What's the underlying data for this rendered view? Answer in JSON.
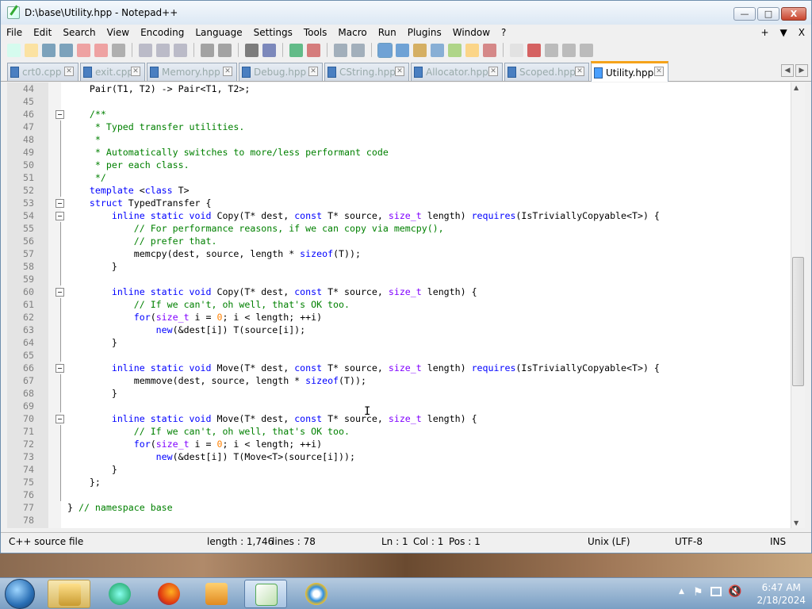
{
  "window": {
    "title": "D:\\base\\Utility.hpp - Notepad++",
    "min_label": "—",
    "max_label": "□",
    "close_label": "X"
  },
  "menu": {
    "items": [
      "File",
      "Edit",
      "Search",
      "View",
      "Encoding",
      "Language",
      "Settings",
      "Tools",
      "Macro",
      "Run",
      "Plugins",
      "Window",
      "?"
    ],
    "right": [
      "+",
      "▼",
      "X"
    ]
  },
  "tabs": [
    {
      "label": "crt0.cpp",
      "active": false
    },
    {
      "label": "exit.cpp",
      "active": false
    },
    {
      "label": "Memory.hpp",
      "active": false
    },
    {
      "label": "Debug.hpp",
      "active": false
    },
    {
      "label": "CString.hpp",
      "active": false
    },
    {
      "label": "Allocator.hpp",
      "active": false
    },
    {
      "label": "Scoped.hpp",
      "active": false
    },
    {
      "label": "Utility.hpp",
      "active": true
    }
  ],
  "code_lines": [
    {
      "n": "44",
      "fold": false,
      "segs": [
        [
          "f",
          "    Pair(T1, T2) -> Pair<T1, T2>;"
        ]
      ]
    },
    {
      "n": "45",
      "fold": false,
      "segs": []
    },
    {
      "n": "46",
      "fold": true,
      "segs": [
        [
          "c",
          "    /**"
        ]
      ]
    },
    {
      "n": "47",
      "fold": false,
      "segs": [
        [
          "c",
          "     * Typed transfer utilities."
        ]
      ]
    },
    {
      "n": "48",
      "fold": false,
      "segs": [
        [
          "c",
          "     *"
        ]
      ]
    },
    {
      "n": "49",
      "fold": false,
      "segs": [
        [
          "c",
          "     * Automatically switches to more/less performant code"
        ]
      ]
    },
    {
      "n": "50",
      "fold": false,
      "segs": [
        [
          "c",
          "     * per each class."
        ]
      ]
    },
    {
      "n": "51",
      "fold": false,
      "segs": [
        [
          "c",
          "     */"
        ]
      ]
    },
    {
      "n": "52",
      "fold": false,
      "segs": [
        [
          "k",
          "    template "
        ],
        [
          "f",
          "<"
        ],
        [
          "k",
          "class"
        ],
        [
          "f",
          " T>"
        ]
      ]
    },
    {
      "n": "53",
      "fold": true,
      "segs": [
        [
          "k",
          "    struct"
        ],
        [
          "f",
          " TypedTransfer {"
        ]
      ]
    },
    {
      "n": "54",
      "fold": true,
      "segs": [
        [
          "k",
          "        inline static void"
        ],
        [
          "f",
          " Copy(T* dest, "
        ],
        [
          "k",
          "const"
        ],
        [
          "f",
          " T* source, "
        ],
        [
          "t",
          "size_t"
        ],
        [
          "f",
          " length) "
        ],
        [
          "k",
          "requires"
        ],
        [
          "f",
          "(IsTriviallyCopyable<T>) {"
        ]
      ]
    },
    {
      "n": "55",
      "fold": false,
      "segs": [
        [
          "c",
          "            // For performance reasons, if we can copy via memcpy(),"
        ]
      ]
    },
    {
      "n": "56",
      "fold": false,
      "segs": [
        [
          "c",
          "            // prefer that."
        ]
      ]
    },
    {
      "n": "57",
      "fold": false,
      "segs": [
        [
          "f",
          "            memcpy(dest, source, length * "
        ],
        [
          "k",
          "sizeof"
        ],
        [
          "f",
          "(T));"
        ]
      ]
    },
    {
      "n": "58",
      "fold": false,
      "segs": [
        [
          "f",
          "        }"
        ]
      ]
    },
    {
      "n": "59",
      "fold": false,
      "segs": []
    },
    {
      "n": "60",
      "fold": true,
      "segs": [
        [
          "k",
          "        inline static void"
        ],
        [
          "f",
          " Copy(T* dest, "
        ],
        [
          "k",
          "const"
        ],
        [
          "f",
          " T* source, "
        ],
        [
          "t",
          "size_t"
        ],
        [
          "f",
          " length) {"
        ]
      ]
    },
    {
      "n": "61",
      "fold": false,
      "segs": [
        [
          "c",
          "            // If we can't, oh well, that's OK too."
        ]
      ]
    },
    {
      "n": "62",
      "fold": false,
      "segs": [
        [
          "k",
          "            for"
        ],
        [
          "f",
          "("
        ],
        [
          "t",
          "size_t"
        ],
        [
          "f",
          " i = "
        ],
        [
          "n",
          "0"
        ],
        [
          "f",
          "; i < length; ++i)"
        ]
      ]
    },
    {
      "n": "63",
      "fold": false,
      "segs": [
        [
          "k",
          "                new"
        ],
        [
          "f",
          "(&dest[i]) T(source[i]);"
        ]
      ]
    },
    {
      "n": "64",
      "fold": false,
      "segs": [
        [
          "f",
          "        }"
        ]
      ]
    },
    {
      "n": "65",
      "fold": false,
      "segs": []
    },
    {
      "n": "66",
      "fold": true,
      "segs": [
        [
          "k",
          "        inline static void"
        ],
        [
          "f",
          " Move(T* dest, "
        ],
        [
          "k",
          "const"
        ],
        [
          "f",
          " T* source, "
        ],
        [
          "t",
          "size_t"
        ],
        [
          "f",
          " length) "
        ],
        [
          "k",
          "requires"
        ],
        [
          "f",
          "(IsTriviallyCopyable<T>) {"
        ]
      ]
    },
    {
      "n": "67",
      "fold": false,
      "segs": [
        [
          "f",
          "            memmove(dest, source, length * "
        ],
        [
          "k",
          "sizeof"
        ],
        [
          "f",
          "(T));"
        ]
      ]
    },
    {
      "n": "68",
      "fold": false,
      "segs": [
        [
          "f",
          "        }"
        ]
      ]
    },
    {
      "n": "69",
      "fold": false,
      "segs": []
    },
    {
      "n": "70",
      "fold": true,
      "segs": [
        [
          "k",
          "        inline static void"
        ],
        [
          "f",
          " Move(T* dest, "
        ],
        [
          "k",
          "const"
        ],
        [
          "f",
          " T* source, "
        ],
        [
          "t",
          "size_t"
        ],
        [
          "f",
          " length) {"
        ]
      ]
    },
    {
      "n": "71",
      "fold": false,
      "segs": [
        [
          "c",
          "            // If we can't, oh well, that's OK too."
        ]
      ]
    },
    {
      "n": "72",
      "fold": false,
      "segs": [
        [
          "k",
          "            for"
        ],
        [
          "f",
          "("
        ],
        [
          "t",
          "size_t"
        ],
        [
          "f",
          " i = "
        ],
        [
          "n",
          "0"
        ],
        [
          "f",
          "; i < length; ++i)"
        ]
      ]
    },
    {
      "n": "73",
      "fold": false,
      "segs": [
        [
          "k",
          "                new"
        ],
        [
          "f",
          "(&dest[i]) T(Move<T>(source[i]));"
        ]
      ]
    },
    {
      "n": "74",
      "fold": false,
      "segs": [
        [
          "f",
          "        }"
        ]
      ]
    },
    {
      "n": "75",
      "fold": false,
      "segs": [
        [
          "f",
          "    };"
        ]
      ]
    },
    {
      "n": "76",
      "fold": false,
      "segs": []
    },
    {
      "n": "77",
      "fold": false,
      "segs": [
        [
          "f",
          "} "
        ],
        [
          "c",
          "// namespace base"
        ]
      ]
    },
    {
      "n": "78",
      "fold": false,
      "segs": []
    }
  ],
  "status": {
    "type": "C++ source file",
    "length": "length : 1,746",
    "lines": "lines : 78",
    "ln": "Ln : 1",
    "col": "Col : 1",
    "pos": "Pos : 1",
    "eol": "Unix (LF)",
    "encoding": "UTF-8",
    "mode": "INS"
  },
  "clock": {
    "time": "6:47 AM",
    "date": "2/18/2024"
  },
  "icons": {
    "toolbar": [
      "new-file-icon",
      "open-file-icon",
      "save-icon",
      "save-all-icon",
      "close-icon",
      "close-all-icon",
      "print-icon",
      "cut-icon",
      "copy-icon",
      "paste-icon",
      "undo-icon",
      "redo-icon",
      "find-icon",
      "replace-icon",
      "zoom-in-icon",
      "zoom-out-icon",
      "sync-v-icon",
      "sync-h-icon",
      "word-wrap-icon",
      "show-all-icon",
      "indent-guide-icon",
      "doc-map-icon",
      "function-list-icon",
      "folder-workspace-icon",
      "monitor-icon",
      "record-macro-icon",
      "stop-macro-icon",
      "play-macro-icon",
      "play-multi-icon",
      "save-macro-icon"
    ],
    "taskbar": [
      "explorer-icon",
      "media-icon",
      "firefox-icon",
      "media-player-icon",
      "notepadpp-icon",
      "ie-icon"
    ]
  },
  "colors": {
    "keyword": "#0000ff",
    "type": "#8000ff",
    "comment": "#008000",
    "number": "#ff8000",
    "active_tab_accent": "#f5a31a"
  }
}
